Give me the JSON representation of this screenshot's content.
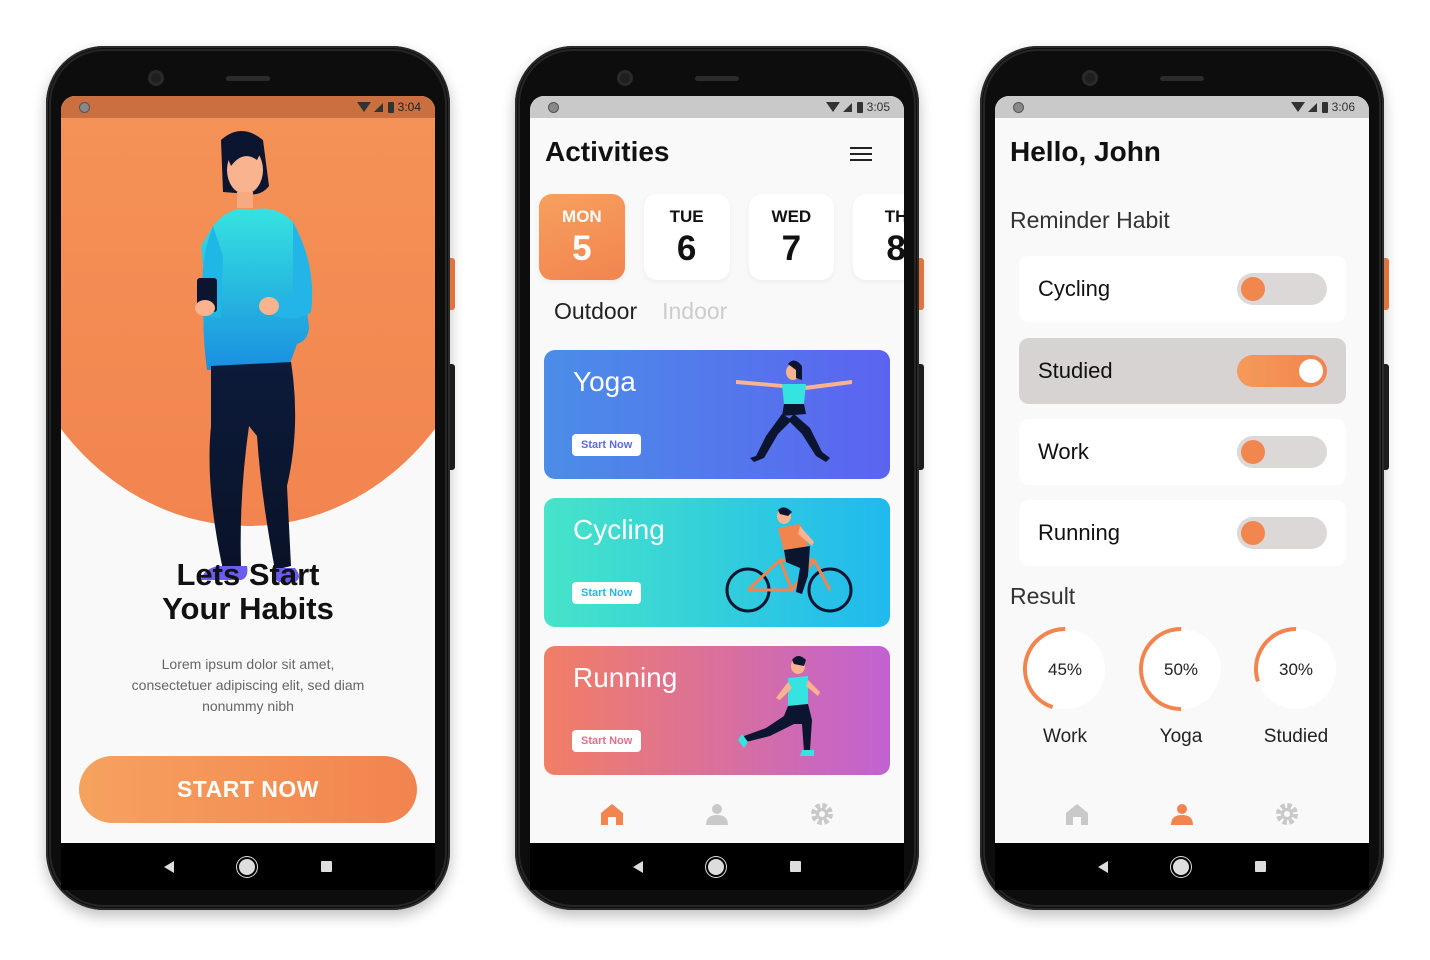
{
  "screen1": {
    "status_time": "3:04",
    "title_line1": "Lets Start",
    "title_line2": "Your Habits",
    "description": "Lorem ipsum dolor sit amet, consectetuer adipiscing elit, sed diam nonummy nibh",
    "start_button": "START NOW"
  },
  "screen2": {
    "status_time": "3:05",
    "title": "Activities",
    "days": [
      {
        "name": "MON",
        "date": "5",
        "active": true
      },
      {
        "name": "TUE",
        "date": "6",
        "active": false
      },
      {
        "name": "WED",
        "date": "7",
        "active": false
      },
      {
        "name": "TH",
        "date": "8",
        "active": false
      }
    ],
    "tabs": {
      "outdoor": "Outdoor",
      "indoor": "Indoor"
    },
    "cards": [
      {
        "title": "Yoga",
        "button": "Start Now"
      },
      {
        "title": "Cycling",
        "button": "Start Now"
      },
      {
        "title": "Running",
        "button": "Start Now"
      }
    ]
  },
  "screen3": {
    "status_time": "3:06",
    "title": "Hello, John",
    "reminder_heading": "Reminder Habit",
    "habits": [
      {
        "label": "Cycling",
        "enabled": false
      },
      {
        "label": "Studied",
        "enabled": true
      },
      {
        "label": "Work",
        "enabled": false
      },
      {
        "label": "Running",
        "enabled": false
      }
    ],
    "result_heading": "Result",
    "results": [
      {
        "label": "Work",
        "percent_text": "45%",
        "percent": 45
      },
      {
        "label": "Yoga",
        "percent_text": "50%",
        "percent": 50
      },
      {
        "label": "Studied",
        "percent_text": "30%",
        "percent": 30
      }
    ]
  },
  "colors": {
    "accent": "#f2844f",
    "accent_light": "#f6a25f",
    "track": "#dcd8d8"
  },
  "icons": {
    "bottom_tabs": [
      "home-icon",
      "profile-icon",
      "settings-icon"
    ],
    "header_menu": "hamburger-menu-icon",
    "android_nav": [
      "back-icon",
      "home-circle-icon",
      "recents-icon"
    ]
  }
}
